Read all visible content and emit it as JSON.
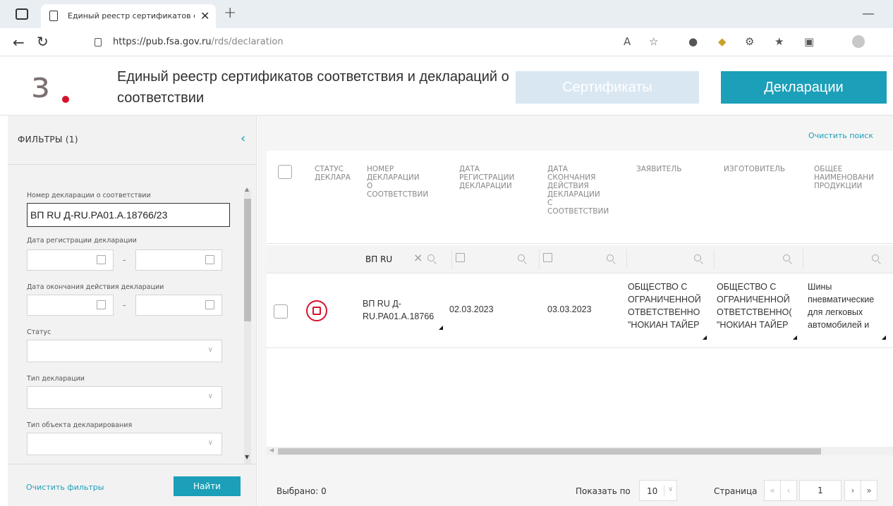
{
  "browser": {
    "tab_title": "Единый реестр сертификатов с",
    "url_main": "https://pub.fsa.gov.ru",
    "url_path": "/rds/declaration"
  },
  "header": {
    "logo_letter": "з",
    "title": "Единый реестр сертификатов соответствия и деклараций о соответствии",
    "certificates_tab": "Сертификаты",
    "declarations_tab": "Декларации"
  },
  "filters": {
    "title": "ФИЛЬТРЫ (1)",
    "decl_number_label": "Номер декларации о соответствии",
    "decl_number_value": "ВП RU Д-RU.PA01.A.18766/23",
    "reg_date_label": "Дата регистрации декларации",
    "end_date_label": "Дата окончания действия декларации",
    "status_label": "Статус",
    "decl_type_label": "Тип декларации",
    "object_type_label": "Тип объекта декларирования",
    "dash": "-",
    "clear_filters": "Очистить фильтры",
    "find": "Найти"
  },
  "main": {
    "clear_search": "Очистить поиск",
    "columns": [
      {
        "key": "status",
        "label": "СТАТУС\nДЕКЛАРА"
      },
      {
        "key": "number",
        "label": "НОМЕР\nДЕКЛАРАЦИИ\nО\nСООТВЕТСТВИИ"
      },
      {
        "key": "reg_date",
        "label": "ДАТА\nРЕГИСТРАЦИИ\nДЕКЛАРАЦИИ"
      },
      {
        "key": "end_date",
        "label": "ДАТА\nСКОНЧАНИЯ\nДЕЙСТВИЯ\nДЕКЛАРАЦИИ\nС\nСООТВЕТСТВИИ"
      },
      {
        "key": "applicant",
        "label": "ЗАЯВИТЕЛЬ"
      },
      {
        "key": "manufacturer",
        "label": "ИЗГОТОВИТЕЛЬ"
      },
      {
        "key": "product",
        "label": "ОБЩЕЕ\nНАИМЕНОВАНИ\nПРОДУКЦИИ"
      }
    ],
    "number_filter": "ВП RU",
    "row": {
      "number": "ВП RU Д-\nRU.PA01.A.18766",
      "reg_date": "02.03.2023",
      "end_date": "03.03.2023",
      "applicant": "ОБЩЕСТВО С\nОГРАНИЧЕННОЙ\nОТВЕТСТВЕННО\n\"НОКИАН ТАЙЕР",
      "manufacturer": "ОБЩЕСТВО С\nОГРАНИЧЕННОЙ\nОТВЕТСТВЕННО(\n\"НОКИАН ТАЙЕР",
      "product": "Шины\nпневматические\nдля легковых\nавтомобилей и"
    },
    "selected": "Выбрано: 0",
    "show_by": "Показать по",
    "per_page": "10",
    "page_label": "Страница",
    "page_first": "«",
    "page_prev": "‹",
    "page_value": "1",
    "page_next": "›",
    "page_last": "»"
  },
  "colors": {
    "accent": "#1c9fb8",
    "status_red": "#d6122b",
    "cert_tab_bg": "#d9e7f2"
  }
}
